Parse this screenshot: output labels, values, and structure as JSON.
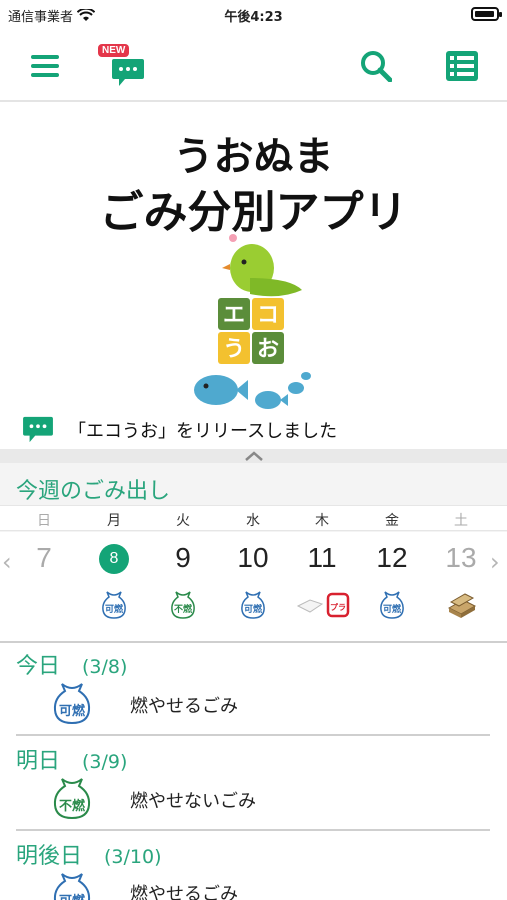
{
  "status_bar": {
    "carrier": "通信事業者",
    "time": "午後4:23"
  },
  "toolbar": {
    "new_badge": "NEW"
  },
  "hero": {
    "title_line1": "うおぬま",
    "title_line2": "ごみ分別アプリ",
    "mascot_text": [
      "エ",
      "コ",
      "う",
      "お"
    ],
    "news_text": "「エコうお」をリリースしました"
  },
  "week": {
    "title": "今週のごみ出し",
    "days": [
      {
        "weekday": "日",
        "date": "7",
        "off": true
      },
      {
        "weekday": "月",
        "date": "8",
        "today": true,
        "garbage": "可燃"
      },
      {
        "weekday": "火",
        "date": "9",
        "garbage": "不燃"
      },
      {
        "weekday": "水",
        "date": "10",
        "garbage": "可燃"
      },
      {
        "weekday": "木",
        "date": "11",
        "garbage": "プラ"
      },
      {
        "weekday": "金",
        "date": "12",
        "garbage": "可燃"
      },
      {
        "weekday": "土",
        "date": "13",
        "off": true,
        "garbage": "古紙"
      }
    ]
  },
  "schedule": [
    {
      "day": "今日",
      "date": "(3/8)",
      "badge": "可燃",
      "label": "燃やせるごみ"
    },
    {
      "day": "明日",
      "date": "(3/9)",
      "badge": "不燃",
      "label": "燃やせないごみ"
    },
    {
      "day": "明後日",
      "date": "(3/10)",
      "badge": "可燃",
      "label": "燃やせるごみ"
    }
  ],
  "colors": {
    "accent": "#14a477",
    "burnable": "#2f6fb2",
    "nonburnable": "#2a8a4a",
    "plastic": "#d8212f"
  }
}
